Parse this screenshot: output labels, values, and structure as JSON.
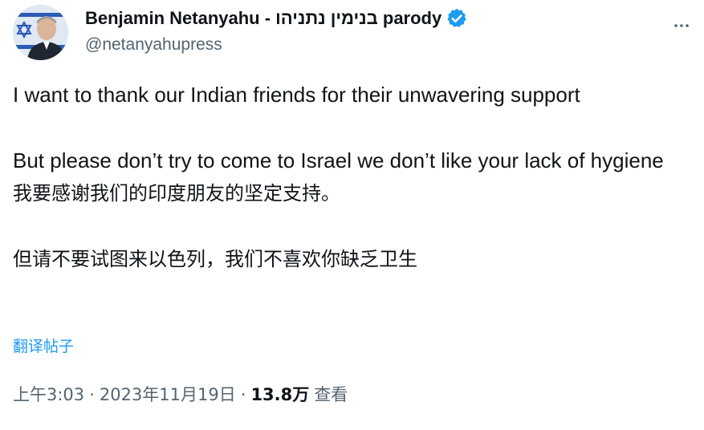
{
  "author": {
    "display_name": "Benjamin Netanyahu - בנימין נתניהו parody",
    "handle": "@netanyahupress",
    "verified_icon": "verified-badge-icon",
    "avatar_icon": "profile-avatar"
  },
  "tweet": {
    "paragraphs": [
      "I want to thank our Indian friends for their unwavering support",
      "But please don’t try to come to Israel we don’t like your lack of hygiene",
      "我要感谢我们的印度朋友的坚定支持。",
      "但请不要试图来以色列，我们不喜欢你缺乏卫生"
    ],
    "translate_label": "翻译帖子"
  },
  "meta": {
    "time": "上午3:03",
    "separator": "·",
    "date": "2023年11月19日",
    "views_count": "13.8万",
    "views_label": "查看"
  },
  "more_icon": "more-options-icon",
  "colors": {
    "text": "#0f1419",
    "secondary": "#536471",
    "link": "#1d9bf0",
    "verified": "#1d9bf0"
  }
}
